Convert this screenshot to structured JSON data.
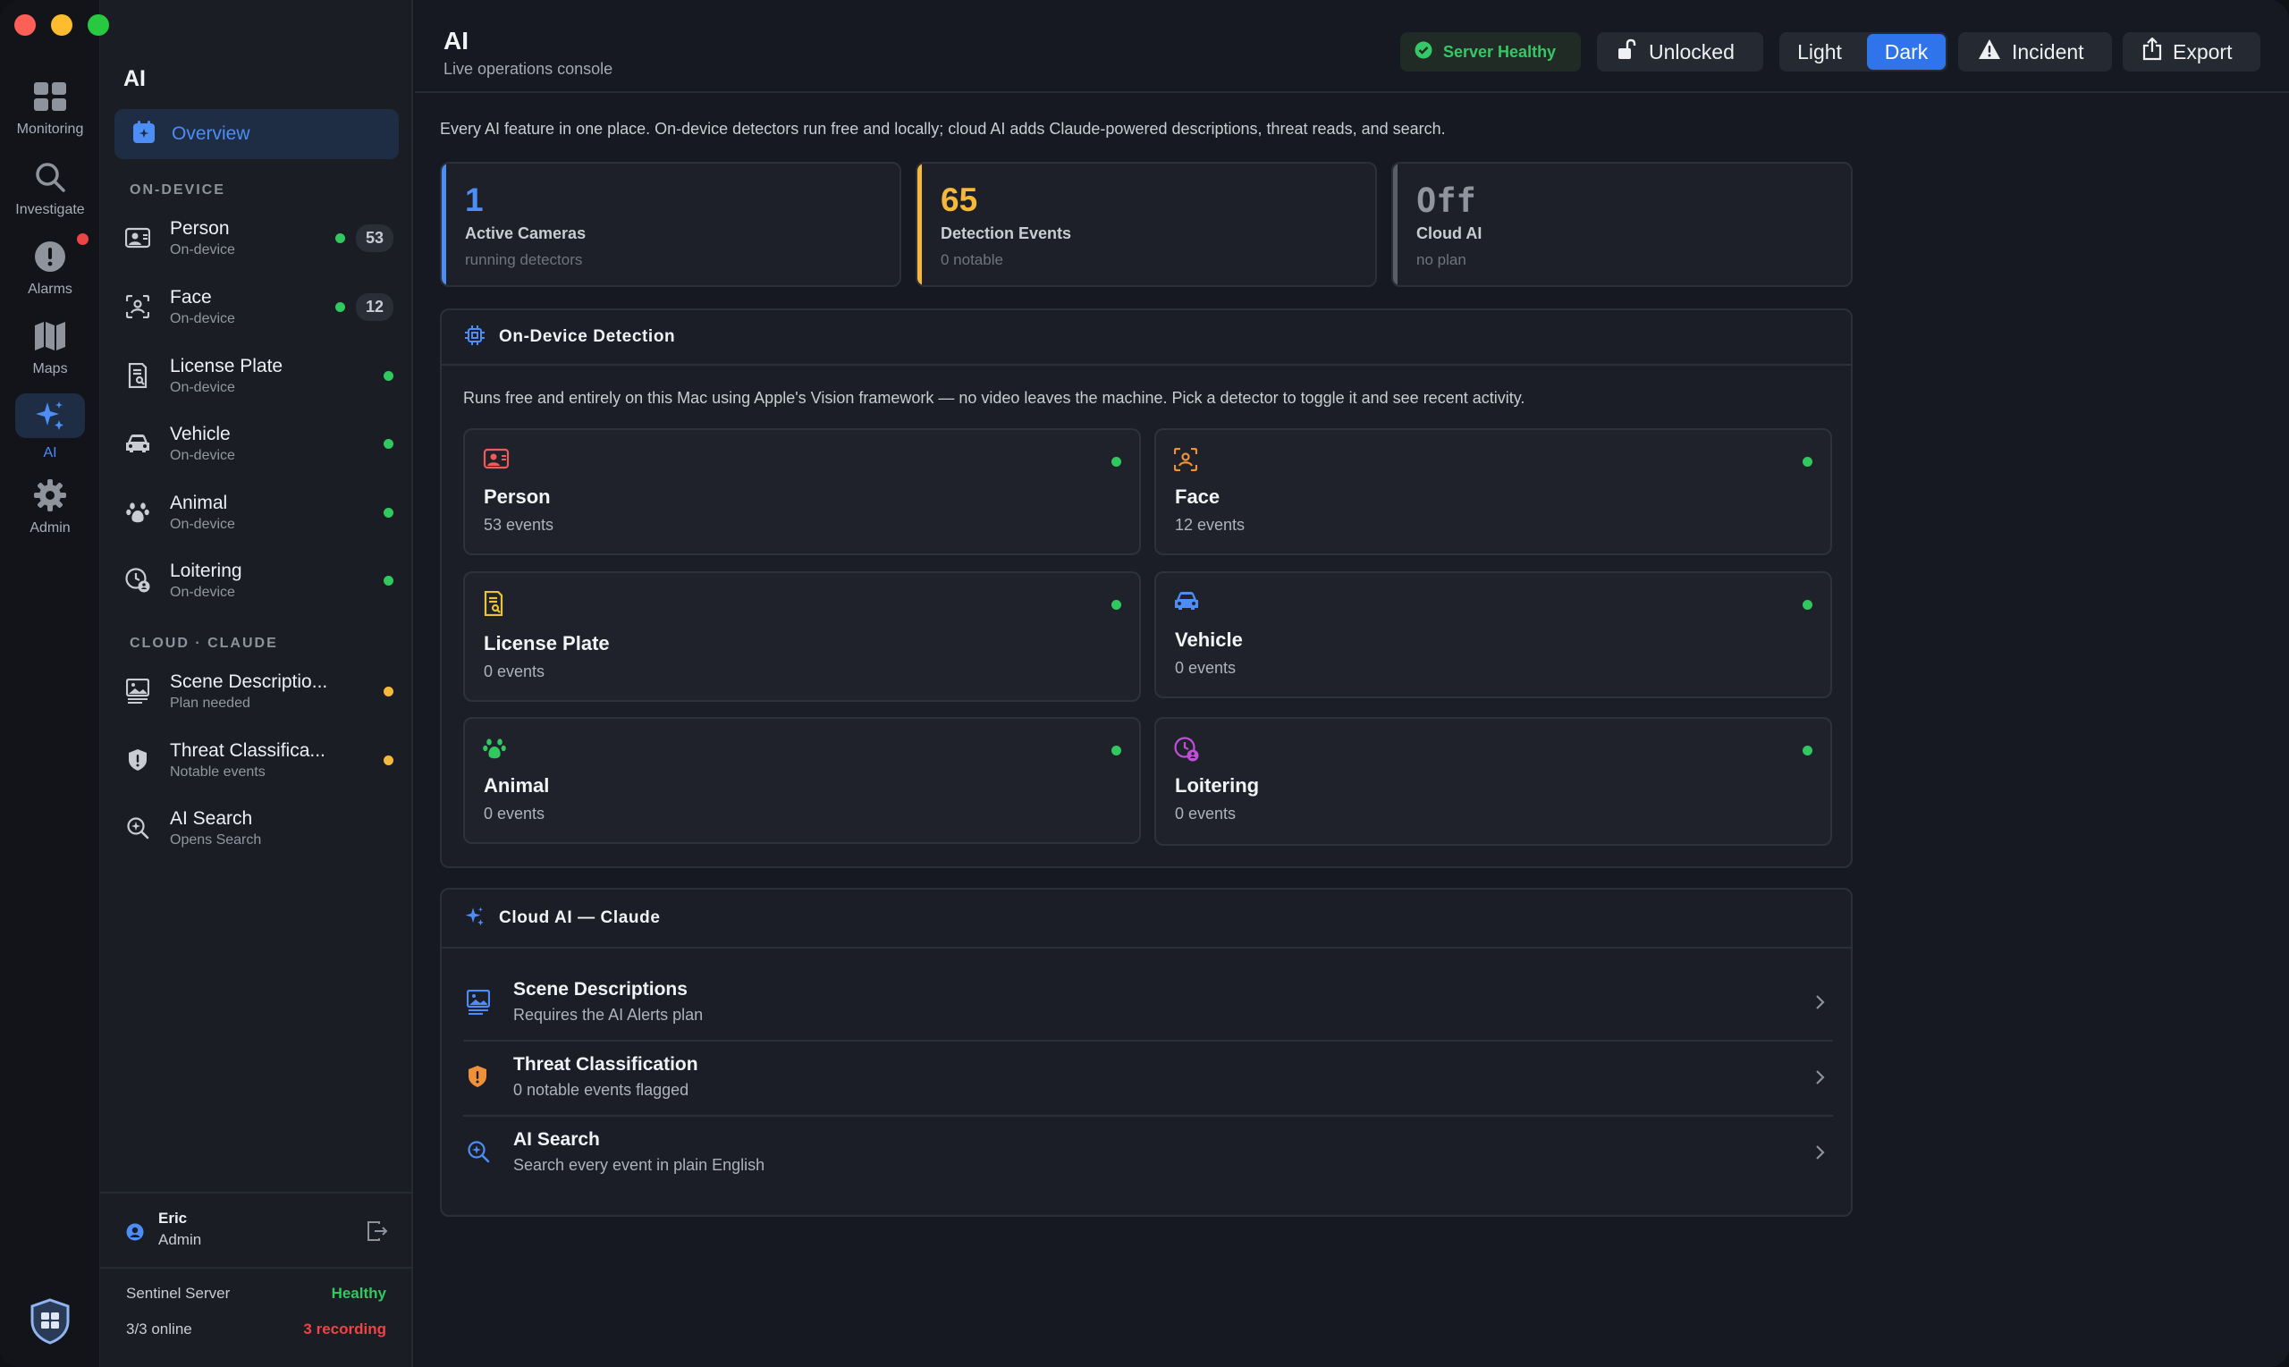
{
  "app": {
    "title": "AI",
    "subtitle": "Live operations console"
  },
  "rail": {
    "items": [
      {
        "label": "Monitoring",
        "icon": "grid-icon"
      },
      {
        "label": "Investigate",
        "icon": "search-icon"
      },
      {
        "label": "Alarms",
        "icon": "alert-icon"
      },
      {
        "label": "Maps",
        "icon": "map-icon"
      },
      {
        "label": "AI",
        "icon": "sparkle-icon"
      },
      {
        "label": "Admin",
        "icon": "gear-icon"
      }
    ]
  },
  "sidebar": {
    "title": "AI",
    "overview": "Overview",
    "section_device": "ON-DEVICE",
    "section_cloud": "CLOUD · CLAUDE",
    "device_items": [
      {
        "name": "Person",
        "sub": "On-device",
        "count": "53"
      },
      {
        "name": "Face",
        "sub": "On-device",
        "count": "12"
      },
      {
        "name": "License Plate",
        "sub": "On-device"
      },
      {
        "name": "Vehicle",
        "sub": "On-device"
      },
      {
        "name": "Animal",
        "sub": "On-device"
      },
      {
        "name": "Loitering",
        "sub": "On-device"
      }
    ],
    "cloud_items": [
      {
        "name": "Scene Descriptio...",
        "sub": "Plan needed"
      },
      {
        "name": "Threat Classifica...",
        "sub": "Notable events"
      },
      {
        "name": "AI Search",
        "sub": "Opens Search"
      }
    ],
    "user": {
      "name": "Eric",
      "role": "Admin"
    },
    "server": {
      "name": "Sentinel Server",
      "status": "Healthy",
      "online": "3/3 online",
      "recording": "3 recording"
    }
  },
  "header": {
    "health": "Server Healthy",
    "lock": "Unlocked",
    "theme_light": "Light",
    "theme_dark": "Dark",
    "incident": "Incident",
    "export": "Export"
  },
  "intro": "Every AI feature in one place. On-device detectors run free and locally; cloud AI adds Claude-powered descriptions, threat reads, and search.",
  "stats": [
    {
      "value": "1",
      "label": "Active Cameras",
      "sub": "running detectors",
      "color": "#4c8df6"
    },
    {
      "value": "65",
      "label": "Detection Events",
      "sub": "0 notable",
      "color": "#f5b83a"
    },
    {
      "value": "Off",
      "label": "Cloud AI",
      "sub": "no plan",
      "color": "#8f949e"
    }
  ],
  "detection": {
    "title": "On-Device Detection",
    "desc": "Runs free and entirely on this Mac using Apple's Vision framework — no video leaves the machine. Pick a detector to toggle it and see recent activity.",
    "cards": [
      {
        "name": "Person",
        "events": "53 events"
      },
      {
        "name": "Face",
        "events": "12 events"
      },
      {
        "name": "License Plate",
        "events": "0 events"
      },
      {
        "name": "Vehicle",
        "events": "0 events"
      },
      {
        "name": "Animal",
        "events": "0 events"
      },
      {
        "name": "Loitering",
        "events": "0 events"
      }
    ]
  },
  "cloud": {
    "title": "Cloud AI — Claude",
    "rows": [
      {
        "name": "Scene Descriptions",
        "sub": "Requires the AI Alerts plan"
      },
      {
        "name": "Threat Classification",
        "sub": "0 notable events flagged"
      },
      {
        "name": "AI Search",
        "sub": "Search every event in plain English"
      }
    ]
  }
}
